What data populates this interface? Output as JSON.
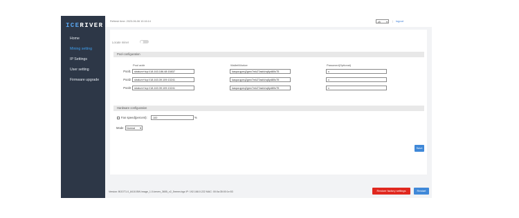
{
  "brand": {
    "logo_ice": "ICE",
    "logo_rest": "RIVER"
  },
  "sidebar": {
    "items": [
      {
        "label": "Home",
        "active": false
      },
      {
        "label": "Mining setting",
        "active": true
      },
      {
        "label": "IP Settings",
        "active": false
      },
      {
        "label": "User setting",
        "active": false
      },
      {
        "label": "Firmware upgrade",
        "active": false
      }
    ]
  },
  "header": {
    "refresh_text": "Refresh time: 2023-06-06 10:16:14",
    "language": "zh",
    "separator": "|",
    "logout_label": "logout"
  },
  "locate": {
    "label": "Locate miner",
    "enabled": false
  },
  "pool_config": {
    "section_title": "Pool configuration",
    "columns": {
      "addr": "Pool addr",
      "wallet": "Wallet/Worker",
      "password": "Password(Optional)"
    },
    "rows": [
      {
        "label": "Pool1",
        "addr": "stratum+tcp://18.163.186.48:15837",
        "wallet": "kaspa:qpeq2gmv7mk27asfuhq6yd80sT5",
        "password": "x"
      },
      {
        "label": "Pool2",
        "addr": "stratum+tcp://18.163.39.109:13241",
        "wallet": "kaspa:qpeq2gmv7mk27asfuhq6yd80sT5",
        "password": "x"
      },
      {
        "label": "Pool3",
        "addr": "stratum+tcp://18.163.39.109:13241",
        "wallet": "kaspa:qpeq2gmv7mk27asfuhq6yd80sT5",
        "password": "x"
      }
    ]
  },
  "hardware_config": {
    "section_title": "Hardware configuration",
    "fan_label": "Fan speed(percent):",
    "fan_value": "100",
    "fan_unit": "%",
    "mode_label": "Mode",
    "mode_value": "Normal"
  },
  "actions": {
    "save_label": "Save",
    "restore_label": "Restore factory settings",
    "restart_label": "Restart"
  },
  "footer": {
    "version_text": "Version: BOOT1.0_8410.BIN image_1.0.kerver_3655_v2_5mmm.bgz   IP: 192.168.0.222   MAC: 00:0a:35:00:1e:53"
  },
  "colors": {
    "sidebar_bg": "#2d3747",
    "accent": "#3f88d8",
    "danger": "#e0281f",
    "active_nav": "#3fa0f0"
  }
}
